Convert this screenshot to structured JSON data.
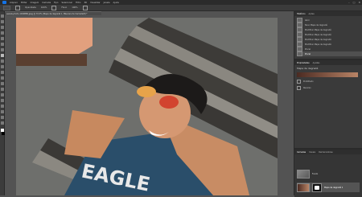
{
  "menubar": {
    "items": [
      "Arquivo",
      "Editar",
      "Imagem",
      "Camada",
      "Tipo",
      "Selecionar",
      "Filtro",
      "3D",
      "Visualizar",
      "Janela",
      "Ajuda"
    ]
  },
  "window_controls": {
    "minimize": "–",
    "maximize": "□",
    "close": "✕"
  },
  "options_bar": {
    "label": "Opacidade",
    "value": "100%",
    "flow_label": "Fluxo",
    "flow_value": "100%"
  },
  "document_tab": {
    "title": "pexels-photo-1040880.jpeg @ 33,3% (Mapa de degradê 1, Máscara de Camada/8) *"
  },
  "right_panel": {
    "top_tabs": [
      "Histórico",
      "Ações"
    ],
    "history_items": [
      "Abrir",
      "Novo Mapa de degradê",
      "Modificar Mapa de degradê",
      "Modificar Mapa de degradê",
      "Modificar Mapa de degradê",
      "Modificar Mapa de degradê",
      "Pincel",
      "Pincel"
    ],
    "properties_tabs": [
      "Propriedades",
      "Ajustes"
    ],
    "properties_title": "Mapa de degradê",
    "dither_label": "Pontilhado",
    "reverse_label": "Reverso",
    "layers_tabs": [
      "Camadas",
      "Canais",
      "Demarcadores"
    ],
    "layers": [
      {
        "name": "Fundo"
      },
      {
        "name": "Mapa de degradê 1"
      }
    ]
  },
  "colors": {
    "foreground": "#ffffff",
    "background": "#000000"
  }
}
